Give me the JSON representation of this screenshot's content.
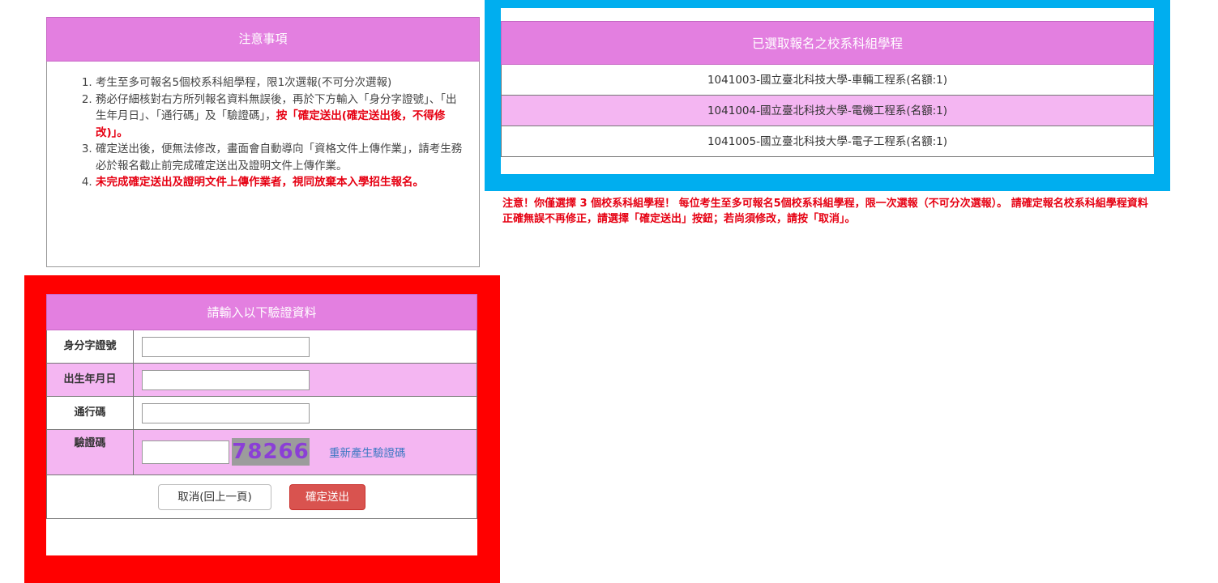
{
  "notes": {
    "title": "注意事項",
    "items": [
      {
        "text": "考生至多可報名5個校系科組學程，限1次選報(不可分次選報)"
      },
      {
        "text": "務必仔細核對右方所列報名資料無誤後，再於下方輸入「身分字證號」、「出生年月日」、「通行碼」及「驗證碼」，",
        "red": "按「確定送出(確定送出後，不得修改)」。"
      },
      {
        "text": "確定送出後，便無法修改，畫面會自動導向「資格文件上傳作業」，請考生務必於報名截止前完成確定送出及證明文件上傳作業。"
      },
      {
        "text": "",
        "red": "未完成確定送出及證明文件上傳作業者，視同放棄本入學招生報名。"
      }
    ]
  },
  "schools": {
    "title": "已選取報名之校系科組學程",
    "rows": [
      "1041003-國立臺北科技大學-車輛工程系(名額:1)",
      "1041004-國立臺北科技大學-電機工程系(名額:1)",
      "1041005-國立臺北科技大學-電子工程系(名額:1)"
    ]
  },
  "warning": "注意！你僅選擇 3 個校系科組學程！ 每位考生至多可報名5個校系科組學程，限一次選報（不可分次選報）。 請確定報名校系科組學程資料正確無誤不再修正，請選擇「確定送出」按鈕；若尚須修改，請按「取消」。",
  "verify": {
    "title": "請輸入以下驗證資料",
    "id_label": "身分字證號",
    "birth_label": "出生年月日",
    "pass_label": "通行碼",
    "captcha_label": "驗證碼",
    "captcha_value": "78266",
    "regen_label": "重新產生驗證碼",
    "cancel_label": "取消(回上一頁)",
    "submit_label": "確定送出"
  },
  "colors": {
    "header": "#e37fe0",
    "row_alt": "#f4b6f2",
    "highlight_blue": "#00aeef",
    "highlight_red": "#ff0000",
    "warning": "#e60012",
    "submit": "#d9534f"
  }
}
